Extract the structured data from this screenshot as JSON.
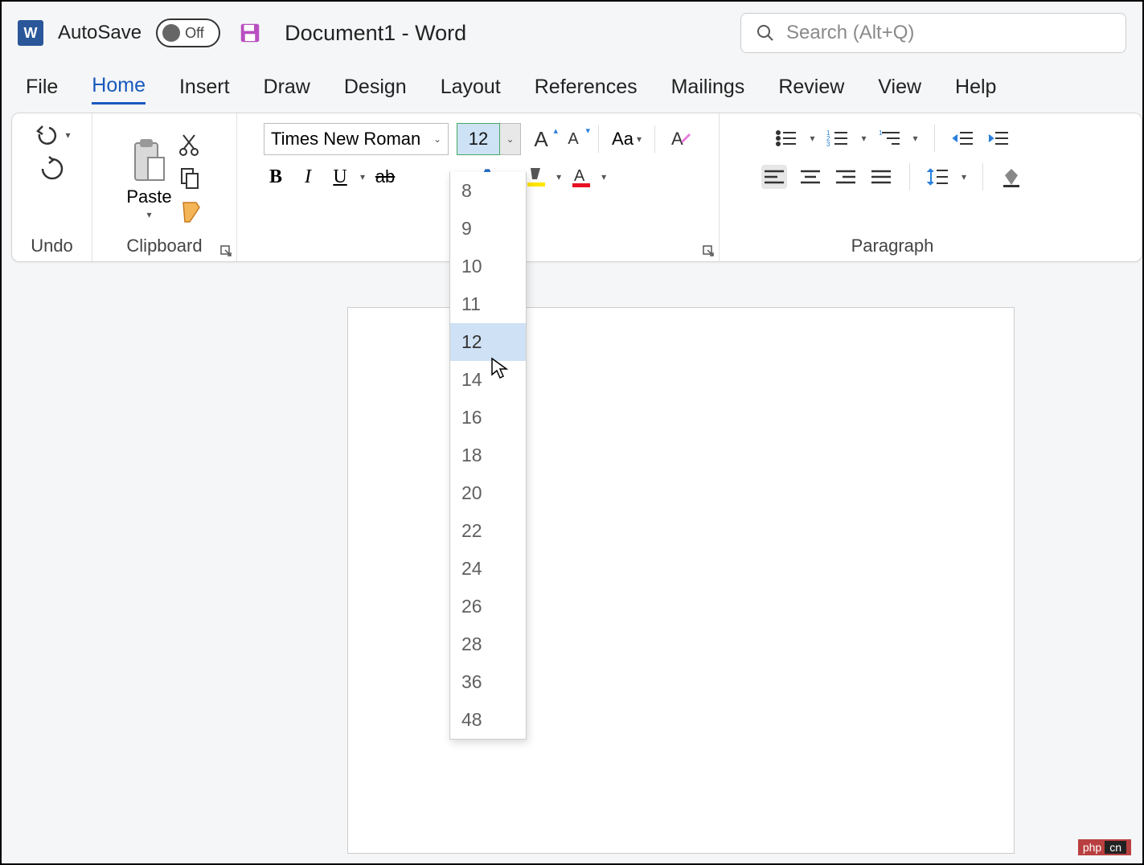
{
  "titlebar": {
    "autosave_label": "AutoSave",
    "autosave_state": "Off",
    "doc_title": "Document1  -  Word",
    "search_placeholder": "Search (Alt+Q)"
  },
  "tabs": {
    "file": "File",
    "home": "Home",
    "insert": "Insert",
    "draw": "Draw",
    "design": "Design",
    "layout": "Layout",
    "references": "References",
    "mailings": "Mailings",
    "review": "Review",
    "view": "View",
    "help": "Help",
    "active": "Home"
  },
  "ribbon": {
    "undo": {
      "label": "Undo"
    },
    "clipboard": {
      "label": "Clipboard",
      "paste_label": "Paste"
    },
    "font": {
      "name": "Times New Roman",
      "size": "12",
      "sizes": [
        "8",
        "9",
        "10",
        "11",
        "12",
        "14",
        "16",
        "18",
        "20",
        "22",
        "24",
        "26",
        "28",
        "36",
        "48"
      ],
      "selected_size": "12",
      "change_case": "Aa"
    },
    "paragraph": {
      "label": "Paragraph"
    }
  },
  "watermark": {
    "t1": "php",
    "t2": "cn"
  }
}
